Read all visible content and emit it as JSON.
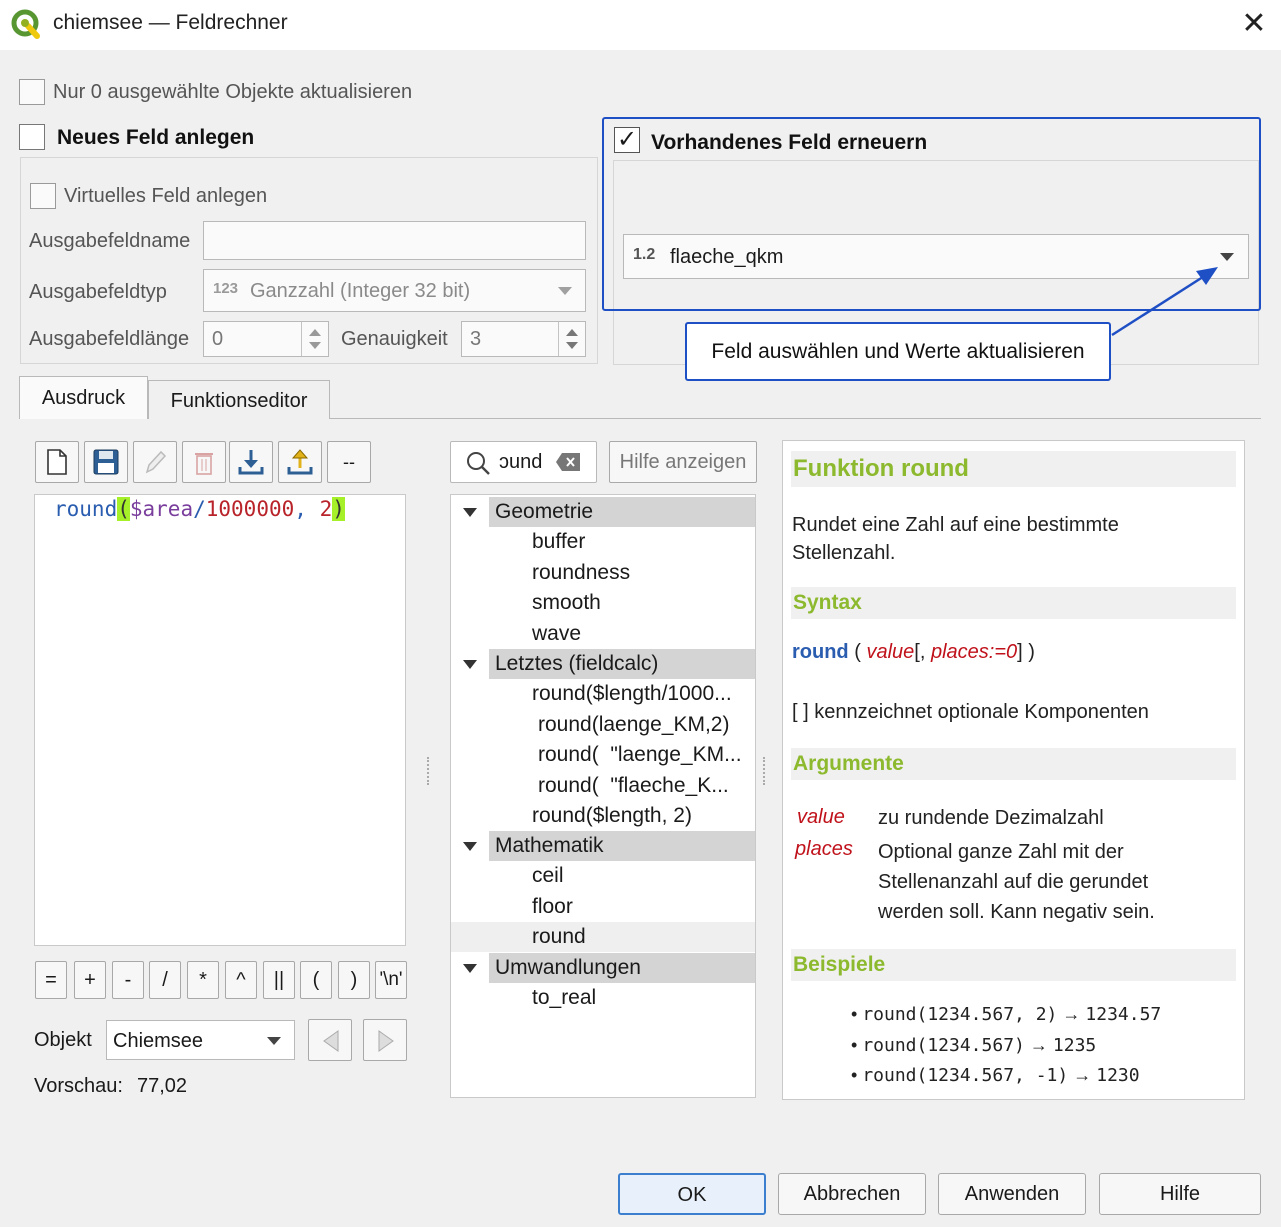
{
  "window": {
    "title": "chiemsee — Feldrechner",
    "close_icon": "close-icon"
  },
  "options": {
    "only_selected_label": "Nur 0 ausgewählte Objekte aktualisieren",
    "new_field_label": "Neues Feld anlegen",
    "virtual_field_label": "Virtuelles Feld anlegen",
    "output_name_label": "Ausgabefeldname",
    "output_name_value": "",
    "output_type_label": "Ausgabefeldtyp",
    "output_type_icon": "123",
    "output_type_value": "Ganzzahl (Integer 32 bit)",
    "output_length_label": "Ausgabefeldlänge",
    "output_length_value": "0",
    "precision_label": "Genauigkeit",
    "precision_value": "3",
    "update_existing_label": "Vorhandenes Feld erneuern",
    "existing_field_type": "1.2",
    "existing_field_value": "flaeche_qkm",
    "callout_text": "Feld auswählen und Werte aktualisieren"
  },
  "tabs": [
    "Ausdruck",
    "Funktionseditor"
  ],
  "editor": {
    "fn": "round",
    "open": "(",
    "var": "$area",
    "slash": "/",
    "num1": "1000000",
    "comma": ", ",
    "num2": "2",
    "close": ")"
  },
  "operators": [
    "=",
    "+",
    "-",
    "/",
    "*",
    "^",
    "||",
    "(",
    ")",
    "'\\n'"
  ],
  "preview": {
    "object_label": "Objekt",
    "object_value": "Chiemsee",
    "preview_label": "Vorschau:",
    "preview_value": "77,02"
  },
  "search": {
    "value": "ɔund",
    "help_button": "Hilfe anzeigen"
  },
  "tree": [
    {
      "label": "Geometrie",
      "group": true
    },
    {
      "label": "buffer"
    },
    {
      "label": "roundness"
    },
    {
      "label": "smooth"
    },
    {
      "label": "wave"
    },
    {
      "label": "Letztes (fieldcalc)",
      "group": true
    },
    {
      "label": "round($length/1000..."
    },
    {
      "label": "round(laenge_KM,2)"
    },
    {
      "label": "round(  \"laenge_KM..."
    },
    {
      "label": "round(  \"flaeche_K..."
    },
    {
      "label": "round($length, 2)"
    },
    {
      "label": "Mathematik",
      "group": true
    },
    {
      "label": "ceil"
    },
    {
      "label": "floor"
    },
    {
      "label": "round"
    },
    {
      "label": "Umwandlungen",
      "group": true
    },
    {
      "label": "to_real"
    }
  ],
  "help": {
    "title": "Funktion round",
    "description": "Rundet eine Zahl auf eine bestimmte Stellenzahl.",
    "syntax_heading": "Syntax",
    "syntax_fn": "round",
    "syntax_open": "(",
    "syntax_arg1": "value",
    "syntax_mid": "[,",
    "syntax_arg2": "places:=0",
    "syntax_close": "] )",
    "optional_note": "[ ] kennzeichnet optionale Komponenten",
    "args_heading": "Argumente",
    "arg1_name": "value",
    "arg1_desc": "zu rundende Dezimalzahl",
    "arg2_name": "places",
    "arg2_desc": "Optional ganze Zahl mit der Stellenanzahl auf die gerundet werden soll. Kann negativ sein.",
    "examples_heading": "Beispiele",
    "examples": [
      {
        "code": "round(1234.567, 2)",
        "result": "1234.57"
      },
      {
        "code": "round(1234.567)",
        "result": "1235"
      },
      {
        "code": "round(1234.567, -1)",
        "result": "1230"
      }
    ]
  },
  "buttons": {
    "ok": "OK",
    "cancel": "Abbrechen",
    "apply": "Anwenden",
    "help": "Hilfe"
  },
  "colors": {
    "accent_blue": "#1f4fc4",
    "help_heading_green": "#8cb92d",
    "argument_red": "#c0121b",
    "bracket_highlight": "#a6f02a"
  }
}
